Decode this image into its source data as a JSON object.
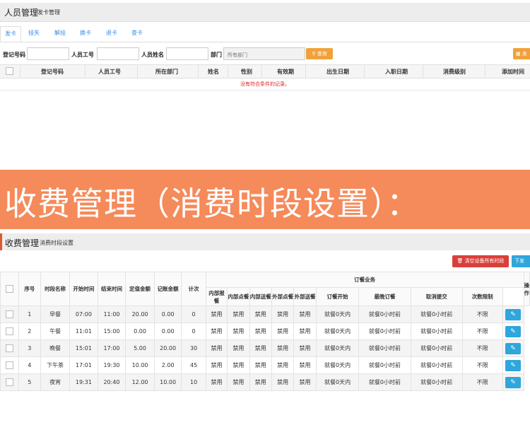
{
  "personnel": {
    "title": "人员管理",
    "subtitle": "发卡管理",
    "tabs": [
      "发卡",
      "挂失",
      "解挂",
      "换卡",
      "退卡",
      "查卡"
    ],
    "filters": {
      "reg_no": "登记号码",
      "emp_no": "人员工号",
      "emp_name": "人员姓名",
      "dept": "部门",
      "dept_value": "所有部门",
      "query_button": "查询",
      "export_button": "发"
    },
    "columns": [
      "登记号码",
      "人员工号",
      "所在部门",
      "姓名",
      "性别",
      "有效期",
      "出生日期",
      "入职日期",
      "消费级别",
      "添加时间"
    ],
    "empty_message": "没有符合条件的记录。"
  },
  "banner": {
    "text": "收费管理（消费时段设置）："
  },
  "fee": {
    "title": "收费管理",
    "subtitle": "消费时段设置",
    "clear_button": "清空设备所有时段",
    "download_button": "下发",
    "headers": {
      "seq": "序号",
      "period": "时段名称",
      "start": "开始时间",
      "end": "结束时间",
      "fixed": "定值金额",
      "account": "记账金额",
      "count": "计次",
      "in_report": "内部报餐",
      "in_checkin": "内部点餐",
      "in_deliver": "内部送餐",
      "out_checkin": "外部点餐",
      "out_deliver": "外部送餐",
      "order_group": "订餐业务",
      "order_start": "订餐开始",
      "latest_order": "最晚订餐",
      "cancel_submit": "取消提交",
      "limit": "次数限制",
      "op": "操作"
    },
    "rows": [
      {
        "seq": "1",
        "name": "早餐",
        "start": "07:00",
        "end": "11:00",
        "fixed": "20.00",
        "account": "0.00",
        "count": "0",
        "b1": "禁用",
        "b2": "禁用",
        "b3": "禁用",
        "b4": "禁用",
        "b5": "禁用",
        "o1": "就餐0天内",
        "o2": "就餐0小时前",
        "o3": "就餐0小时前",
        "limit": "不限"
      },
      {
        "seq": "2",
        "name": "午餐",
        "start": "11:01",
        "end": "15:00",
        "fixed": "0.00",
        "account": "0.00",
        "count": "0",
        "b1": "禁用",
        "b2": "禁用",
        "b3": "禁用",
        "b4": "禁用",
        "b5": "禁用",
        "o1": "就餐0天内",
        "o2": "就餐0小时前",
        "o3": "就餐0小时前",
        "limit": "不限"
      },
      {
        "seq": "3",
        "name": "晚餐",
        "start": "15:01",
        "end": "17:00",
        "fixed": "5.00",
        "account": "20.00",
        "count": "30",
        "b1": "禁用",
        "b2": "禁用",
        "b3": "禁用",
        "b4": "禁用",
        "b5": "禁用",
        "o1": "就餐0天内",
        "o2": "就餐0小时前",
        "o3": "就餐0小时前",
        "limit": "不限"
      },
      {
        "seq": "4",
        "name": "下午茶",
        "start": "17:01",
        "end": "19:30",
        "fixed": "10.00",
        "account": "2.00",
        "count": "45",
        "b1": "禁用",
        "b2": "禁用",
        "b3": "禁用",
        "b4": "禁用",
        "b5": "禁用",
        "o1": "就餐0天内",
        "o2": "就餐0小时前",
        "o3": "就餐0小时前",
        "limit": "不限"
      },
      {
        "seq": "5",
        "name": "夜宵",
        "start": "19:31",
        "end": "20:40",
        "fixed": "12.00",
        "account": "10.00",
        "count": "10",
        "b1": "禁用",
        "b2": "禁用",
        "b3": "禁用",
        "b4": "禁用",
        "b5": "禁用",
        "o1": "就餐0天内",
        "o2": "就餐0小时前",
        "o3": "就餐0小时前",
        "limit": "不限"
      }
    ]
  }
}
